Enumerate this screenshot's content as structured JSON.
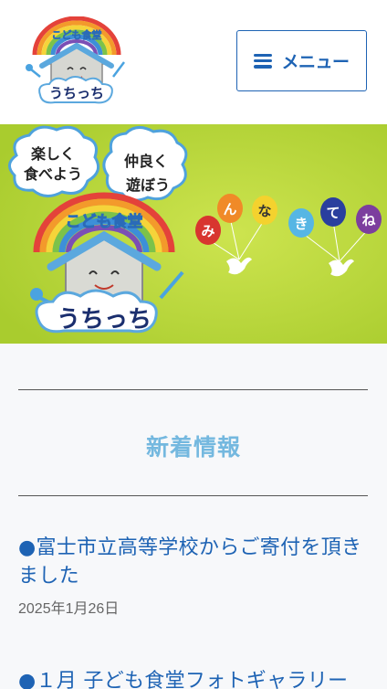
{
  "header": {
    "logo": {
      "arc_text": "こども食堂",
      "name": "うちっち"
    },
    "menu_label": "メニュー"
  },
  "hero": {
    "bubble1": [
      "楽しく",
      "食べよう"
    ],
    "bubble2": [
      "仲良く",
      "遊ぼう"
    ],
    "balloon_chars": [
      "み",
      "ん",
      "な",
      "き",
      "て",
      "ね"
    ],
    "logo_arc_text": "こども食堂",
    "logo_name": "うちっち"
  },
  "news": {
    "heading": "新着情報",
    "posts": [
      {
        "title": "●富士市立高等学校からご寄付を頂きました",
        "date": "2025年1月26日"
      },
      {
        "title": "●１月 子ども食堂フォトギャラリー",
        "date": ""
      }
    ]
  },
  "colors": {
    "brand_blue": "#1e63b4",
    "heading_blue": "#74b8df",
    "hero_green": "#b6d634"
  }
}
